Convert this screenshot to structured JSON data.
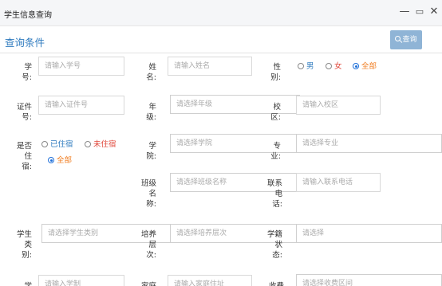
{
  "window": {
    "title": "学生信息查询",
    "minimize_icon": "minimize-icon",
    "restore_icon": "restore-icon",
    "close_icon": "close-icon"
  },
  "panel": {
    "heading": "查询条件",
    "query_button": "查询"
  },
  "colors": {
    "accent": "#2f7bbf",
    "button": "#8fb4d6",
    "female": "#e0473a",
    "all": "#f07c1f"
  },
  "fields": {
    "student_no": {
      "label": "学号:",
      "placeholder": "请输入学号"
    },
    "name": {
      "label": "姓名:",
      "placeholder": "请输入姓名"
    },
    "gender": {
      "label": "性别:",
      "options": [
        "男",
        "女",
        "全部"
      ],
      "selected": "全部"
    },
    "id_no": {
      "label": "证件号:",
      "placeholder": "请输入证件号"
    },
    "grade": {
      "label": "年级:",
      "placeholder": "请选择年级"
    },
    "campus": {
      "label": "校区:",
      "placeholder": "请输入校区"
    },
    "residence": {
      "label": "是否住宿:",
      "options": [
        "已住宿",
        "未住宿",
        "全部"
      ],
      "selected": "全部"
    },
    "college": {
      "label": "学院:",
      "placeholder": "请选择学院"
    },
    "major": {
      "label": "专业:",
      "placeholder": "请选择专业"
    },
    "class_name": {
      "label": "班级名称:",
      "placeholder": "请选择班级名称"
    },
    "phone": {
      "label": "联系电话:",
      "placeholder": "请输入联系电话"
    },
    "student_type": {
      "label": "学生类别:",
      "placeholder": "请选择学生类别"
    },
    "training_level": {
      "label": "培养层次:",
      "placeholder": "请选择培养层次"
    },
    "status": {
      "label": "学籍状态:",
      "placeholder": "请选择"
    },
    "row5_col1": {
      "label": "学",
      "placeholder": "请输入学制"
    },
    "row5_col2": {
      "label": "家庭",
      "placeholder": "请输入家庭住址"
    },
    "row5_col3": {
      "label": "收费",
      "placeholder": "请选择收费区间"
    }
  }
}
